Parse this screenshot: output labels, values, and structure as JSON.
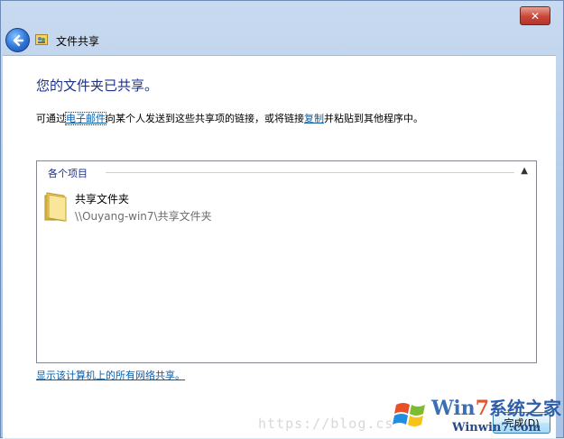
{
  "window": {
    "close_label": "✕",
    "title": "文件共享"
  },
  "main": {
    "heading": "您的文件夹已共享。",
    "description": {
      "part1": "可通过",
      "email_link": "电子邮件",
      "part2": "向某个人发送到这些共享项的链接，或将链接",
      "copy_link": "复制",
      "part3": "并粘贴到其他程序中。"
    },
    "group": {
      "label": "各个项目",
      "collapse_icon": "chevron-up-icon"
    },
    "items": [
      {
        "name": "共享文件夹",
        "path": "\\\\Ouyang-win7\\共享文件夹",
        "icon": "folder-icon"
      }
    ],
    "network_shares_link": "显示该计算机上的所有网络共享。"
  },
  "footer": {
    "done_label": "完成(D)"
  },
  "watermark": {
    "url": "https://blog.cs",
    "logo_win": "Win",
    "logo_7": "7",
    "logo_cn": "系统之家",
    "logo_url": "Winwin7.com"
  },
  "colors": {
    "heading": "#1e3287",
    "link": "#0a5ea8",
    "frame": "#b6cde9"
  }
}
